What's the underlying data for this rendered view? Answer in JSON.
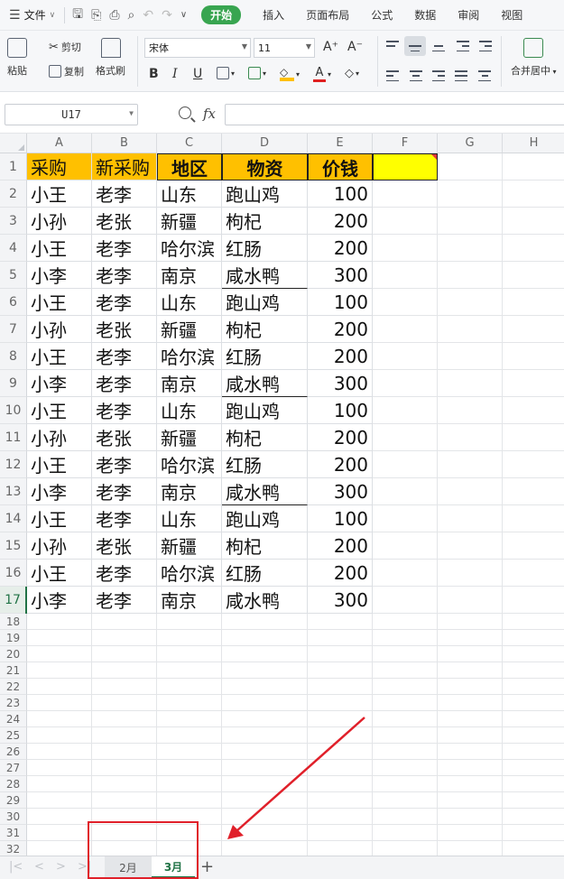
{
  "menu": {
    "file_label": "文件",
    "tabs": [
      {
        "label": "开始",
        "active": true
      },
      {
        "label": "插入"
      },
      {
        "label": "页面布局"
      },
      {
        "label": "公式"
      },
      {
        "label": "数据"
      },
      {
        "label": "审阅"
      },
      {
        "label": "视图"
      }
    ]
  },
  "ribbon": {
    "paste": "粘贴",
    "cut": "剪切",
    "copy": "复制",
    "format_painter": "格式刷",
    "font_name": "宋体",
    "font_size": "11",
    "bold": "B",
    "italic": "I",
    "underline": "U",
    "merge_center": "合并居中"
  },
  "formula_bar": {
    "cell_ref": "U17",
    "fx": "fx",
    "value": ""
  },
  "columns": [
    "A",
    "B",
    "C",
    "D",
    "E",
    "F",
    "G",
    "H"
  ],
  "header_row": [
    "采购",
    "新采购",
    "地区",
    "物资",
    "价钱",
    ""
  ],
  "rows": [
    [
      "小王",
      "老李",
      "山东",
      "跑山鸡",
      "100"
    ],
    [
      "小孙",
      "老张",
      "新疆",
      "枸杞",
      "200"
    ],
    [
      "小王",
      "老李",
      "哈尔滨",
      "红肠",
      "200"
    ],
    [
      "小李",
      "老李",
      "南京",
      "咸水鸭",
      "300"
    ],
    [
      "小王",
      "老李",
      "山东",
      "跑山鸡",
      "100"
    ],
    [
      "小孙",
      "老张",
      "新疆",
      "枸杞",
      "200"
    ],
    [
      "小王",
      "老李",
      "哈尔滨",
      "红肠",
      "200"
    ],
    [
      "小李",
      "老李",
      "南京",
      "咸水鸭",
      "300"
    ],
    [
      "小王",
      "老李",
      "山东",
      "跑山鸡",
      "100"
    ],
    [
      "小孙",
      "老张",
      "新疆",
      "枸杞",
      "200"
    ],
    [
      "小王",
      "老李",
      "哈尔滨",
      "红肠",
      "200"
    ],
    [
      "小李",
      "老李",
      "南京",
      "咸水鸭",
      "300"
    ],
    [
      "小王",
      "老李",
      "山东",
      "跑山鸡",
      "100"
    ],
    [
      "小孙",
      "老张",
      "新疆",
      "枸杞",
      "200"
    ],
    [
      "小王",
      "老李",
      "哈尔滨",
      "红肠",
      "200"
    ],
    [
      "小李",
      "老李",
      "南京",
      "咸水鸭",
      "300"
    ]
  ],
  "empty_row_numbers": [
    "18",
    "19",
    "20",
    "21",
    "22",
    "23",
    "24",
    "25",
    "26",
    "27",
    "28",
    "29",
    "30",
    "31",
    "32"
  ],
  "sheets": [
    {
      "label": "2月",
      "active": false
    },
    {
      "label": "3月",
      "active": true
    }
  ],
  "add_sheet": "+",
  "colors": {
    "accent": "#38a550",
    "header_fill": "#ffc000",
    "highlight_fill": "#ffff00",
    "annotation": "#e0202a"
  }
}
